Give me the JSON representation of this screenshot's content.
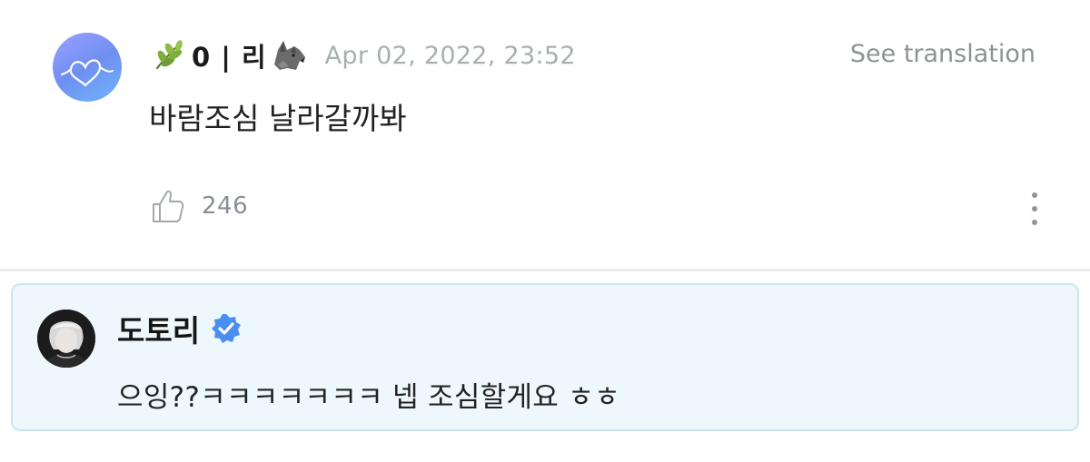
{
  "comment": {
    "author": "0 | 리",
    "author_emoji_prefix": "herb-icon",
    "author_emoji_suffix": "wolf-icon",
    "timestamp": "Apr 02, 2022, 23:52",
    "translate_label": "See translation",
    "body": "바람조심 날라갈까봐",
    "like_count": "246"
  },
  "reply": {
    "author": "도토리",
    "verified": true,
    "body": "으잉??ㅋㅋㅋㅋㅋㅋㅋ 넵 조심할게요 ㅎㅎ"
  },
  "colors": {
    "reply_background": "#eef8fc",
    "reply_border": "#cbe6ef",
    "verified_badge": "#4a8ff0",
    "meta_text": "#a9aeb3"
  }
}
